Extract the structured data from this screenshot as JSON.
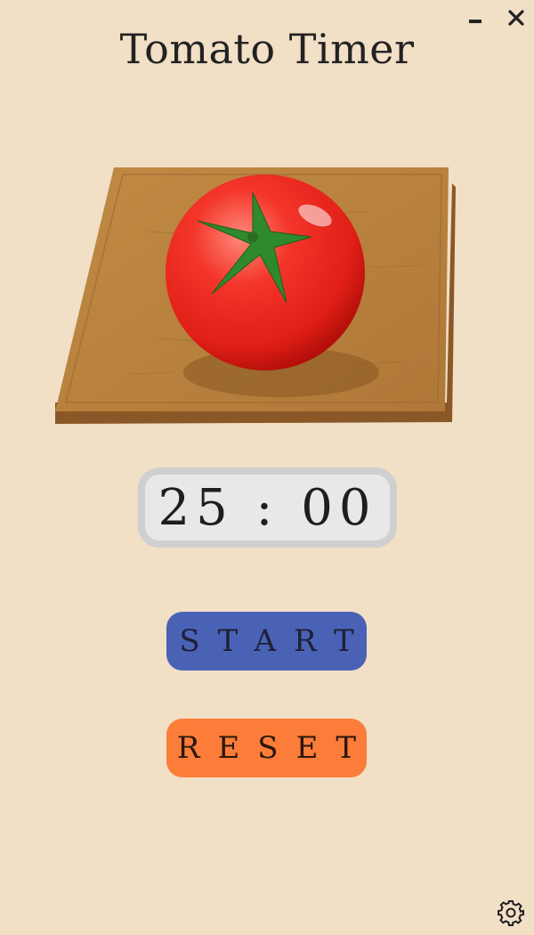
{
  "window": {
    "minimize_icon": "minimize-icon",
    "close_icon": "close-icon"
  },
  "app": {
    "title": "Tomato Timer"
  },
  "timer": {
    "display": "25 : 00"
  },
  "controls": {
    "start_label": "START",
    "reset_label": "RESET"
  },
  "footer": {
    "settings_icon": "gear-icon"
  },
  "colors": {
    "background": "#f1dfc6",
    "start_button": "#4a62b6",
    "reset_button": "#fb7d39",
    "timer_frame": "#cfcfcf",
    "timer_face": "#e8e8e8"
  }
}
